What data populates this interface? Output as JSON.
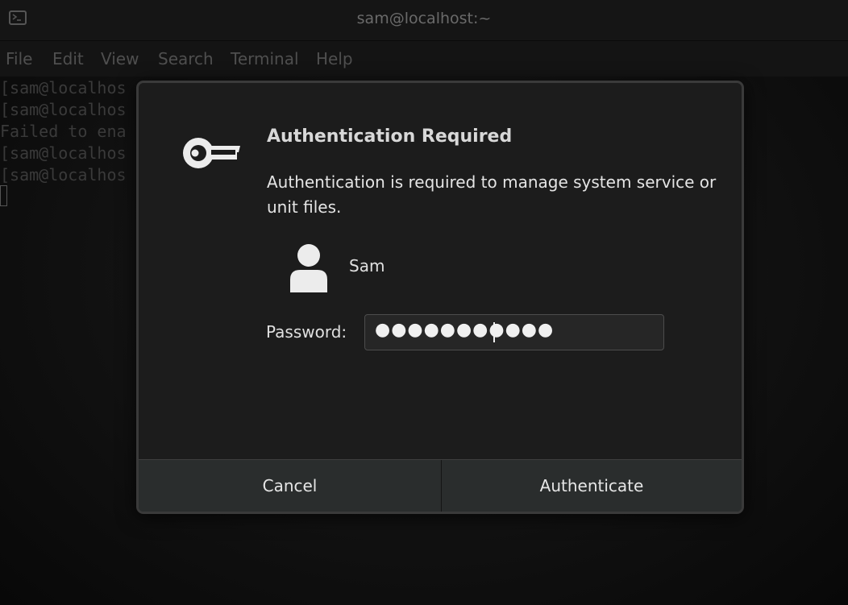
{
  "window": {
    "title": "sam@localhost:~"
  },
  "menu": {
    "items": [
      "File",
      "Edit",
      "View",
      "Search",
      "Terminal",
      "Help"
    ]
  },
  "terminal": {
    "lines": [
      "[sam@localhos",
      "[sam@localhos",
      "Failed to ena",
      "[sam@localhos",
      "[sam@localhos"
    ]
  },
  "dialog": {
    "title": "Authentication Required",
    "message": "Authentication is required to manage system service or unit files.",
    "user": "Sam",
    "password_label": "Password:",
    "password_mask": "●●●●●●●●●●●",
    "cancel_label": "Cancel",
    "authenticate_label": "Authenticate"
  },
  "icons": {
    "terminal": "terminal-icon",
    "key": "key-icon",
    "avatar": "user-avatar-icon"
  },
  "colors": {
    "dialog_bg": "#1c1c1c",
    "button_bar": "#2a2d2d",
    "text": "#e4e4e4"
  }
}
